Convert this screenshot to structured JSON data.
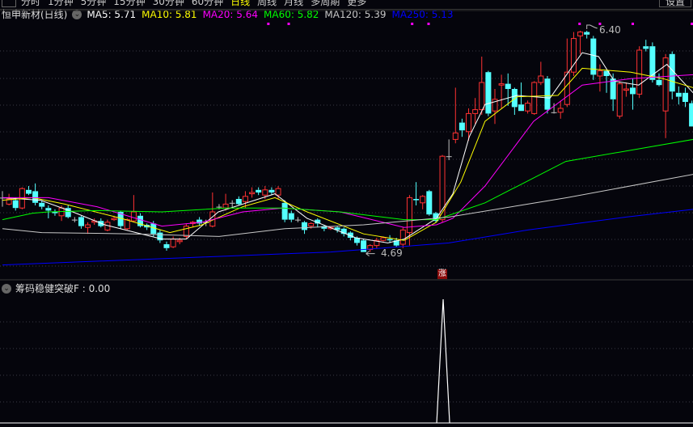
{
  "toolbar": {
    "periods": [
      "分时",
      "1分钟",
      "5分钟",
      "15分钟",
      "30分钟",
      "60分钟",
      "日线",
      "周线",
      "月线",
      "多周期",
      "更多"
    ],
    "active_period": "日线",
    "right_button": "设置"
  },
  "title": {
    "stock": "恒申新材(日线)",
    "ma": [
      {
        "label": "MA5: 5.71",
        "color": "#ffffff"
      },
      {
        "label": "MA10: 5.81",
        "color": "#ffff00"
      },
      {
        "label": "MA20: 5.64",
        "color": "#ff00ff"
      },
      {
        "label": "MA60: 5.82",
        "color": "#00ff00"
      },
      {
        "label": "MA120: 5.39",
        "color": "#c8c8c8"
      },
      {
        "label": "MA250: 5.13",
        "color": "#0000ff"
      }
    ]
  },
  "annotations": {
    "high_label": "6.40",
    "low_label": "4.69",
    "signal_badge": "涨"
  },
  "indicator": {
    "label": "筹码稳健突破F : 0.00"
  },
  "colors": {
    "up": "#ff3232",
    "down": "#54ffff",
    "doji": "#c0c0c0",
    "marker": "#ff00ff"
  },
  "chart_data": {
    "type": "candlestick",
    "price_range": [
      4.5,
      6.48
    ],
    "ohlc": [
      [
        5.11,
        5.16,
        5.04,
        5.11
      ],
      [
        5.06,
        5.14,
        5.05,
        5.1
      ],
      [
        5.09,
        5.11,
        5.01,
        5.03
      ],
      [
        5.03,
        5.19,
        5.02,
        5.18
      ],
      [
        5.17,
        5.2,
        5.13,
        5.14
      ],
      [
        5.16,
        5.22,
        5.05,
        5.07
      ],
      [
        5.07,
        5.09,
        5.02,
        5.04
      ],
      [
        5.03,
        5.05,
        4.95,
        5.01
      ],
      [
        5.0,
        5.02,
        4.97,
        4.99
      ],
      [
        4.97,
        5.05,
        4.93,
        5.03
      ],
      [
        5.03,
        5.05,
        4.95,
        4.96
      ],
      [
        4.94,
        4.96,
        4.92,
        4.94
      ],
      [
        4.96,
        4.97,
        4.87,
        4.89
      ],
      [
        4.88,
        4.92,
        4.83,
        4.9
      ],
      [
        4.92,
        4.95,
        4.9,
        4.93
      ],
      [
        4.93,
        4.95,
        4.88,
        4.89
      ],
      [
        4.86,
        4.94,
        4.85,
        4.92
      ],
      [
        4.94,
        4.97,
        4.93,
        4.95
      ],
      [
        5.0,
        5.01,
        4.87,
        4.89
      ],
      [
        4.87,
        4.95,
        4.86,
        4.94
      ],
      [
        4.93,
        5.13,
        4.92,
        5.0
      ],
      [
        4.97,
        4.99,
        4.88,
        4.89
      ],
      [
        4.9,
        4.91,
        4.86,
        4.88
      ],
      [
        4.91,
        4.93,
        4.81,
        4.83
      ],
      [
        4.84,
        4.86,
        4.76,
        4.78
      ],
      [
        4.75,
        4.77,
        4.7,
        4.72
      ],
      [
        4.73,
        4.81,
        4.72,
        4.79
      ],
      [
        4.77,
        4.8,
        4.75,
        4.78
      ],
      [
        4.81,
        4.91,
        4.79,
        4.89
      ],
      [
        4.91,
        4.93,
        4.88,
        4.92
      ],
      [
        4.94,
        4.96,
        4.89,
        4.91
      ],
      [
        4.92,
        4.94,
        4.89,
        4.92
      ],
      [
        4.89,
        5.15,
        4.88,
        5.0
      ],
      [
        5.04,
        5.06,
        5.02,
        5.04
      ],
      [
        5.03,
        5.14,
        5.01,
        5.06
      ],
      [
        5.07,
        5.09,
        5.03,
        5.07
      ],
      [
        5.1,
        5.12,
        5.05,
        5.06
      ],
      [
        5.08,
        5.16,
        5.03,
        5.12
      ],
      [
        5.14,
        5.19,
        5.11,
        5.15
      ],
      [
        5.17,
        5.19,
        5.13,
        5.15
      ],
      [
        5.13,
        5.2,
        5.1,
        5.17
      ],
      [
        5.17,
        5.19,
        5.13,
        5.15
      ],
      [
        5.13,
        5.2,
        5.1,
        5.18
      ],
      [
        5.07,
        5.09,
        4.92,
        4.94
      ],
      [
        4.99,
        5.01,
        4.92,
        4.94
      ],
      [
        4.94,
        4.96,
        4.92,
        4.94
      ],
      [
        4.92,
        4.93,
        4.83,
        4.86
      ],
      [
        4.89,
        4.92,
        4.87,
        4.91
      ],
      [
        4.94,
        4.95,
        4.88,
        4.91
      ],
      [
        4.89,
        4.9,
        4.85,
        4.87
      ],
      [
        4.87,
        4.89,
        4.86,
        4.88
      ],
      [
        4.88,
        4.89,
        4.84,
        4.86
      ],
      [
        4.87,
        4.88,
        4.81,
        4.83
      ],
      [
        4.84,
        4.85,
        4.78,
        4.8
      ],
      [
        4.8,
        4.81,
        4.74,
        4.76
      ],
      [
        4.78,
        4.79,
        4.69,
        4.69
      ],
      [
        4.71,
        4.75,
        4.69,
        4.74
      ],
      [
        4.74,
        4.8,
        4.72,
        4.78
      ],
      [
        4.78,
        4.81,
        4.77,
        4.8
      ],
      [
        4.79,
        4.82,
        4.76,
        4.78
      ],
      [
        4.78,
        4.8,
        4.73,
        4.74
      ],
      [
        4.75,
        4.88,
        4.72,
        4.86
      ],
      [
        4.84,
        5.13,
        4.74,
        5.11
      ],
      [
        5.1,
        5.23,
        5.05,
        5.09
      ],
      [
        5.07,
        5.13,
        5.02,
        5.12
      ],
      [
        5.16,
        5.17,
        4.97,
        4.98
      ],
      [
        4.99,
        5.0,
        4.92,
        4.93
      ],
      [
        4.94,
        5.44,
        4.92,
        5.43
      ],
      [
        5.43,
        5.56,
        5.4,
        5.43
      ],
      [
        5.56,
        5.96,
        5.53,
        5.61
      ],
      [
        5.69,
        5.72,
        5.58,
        5.63
      ],
      [
        5.62,
        5.8,
        5.55,
        5.76
      ],
      [
        5.76,
        5.88,
        5.68,
        5.79
      ],
      [
        5.79,
        6.2,
        5.75,
        6.0
      ],
      [
        6.08,
        6.09,
        5.74,
        5.76
      ],
      [
        5.78,
        5.95,
        5.68,
        5.87
      ],
      [
        5.98,
        6.06,
        5.8,
        5.99
      ],
      [
        5.99,
        6.07,
        5.82,
        5.95
      ],
      [
        5.95,
        5.96,
        5.75,
        5.81
      ],
      [
        5.83,
        6.0,
        5.78,
        5.78
      ],
      [
        5.78,
        5.86,
        5.76,
        5.84
      ],
      [
        5.76,
        6.01,
        5.75,
        6.0
      ],
      [
        6.0,
        6.16,
        5.98,
        6.05
      ],
      [
        6.03,
        6.05,
        5.76,
        5.79
      ],
      [
        5.77,
        5.84,
        5.76,
        5.77
      ],
      [
        5.77,
        5.86,
        5.72,
        5.8
      ],
      [
        5.83,
        6.34,
        5.81,
        6.08
      ],
      [
        6.08,
        6.39,
        6.05,
        6.34
      ],
      [
        6.36,
        6.4,
        6.22,
        6.39
      ],
      [
        6.39,
        6.4,
        6.34,
        6.37
      ],
      [
        6.34,
        6.36,
        6.02,
        6.06
      ],
      [
        6.05,
        6.14,
        5.93,
        6.09
      ],
      [
        6.09,
        6.1,
        5.92,
        6.05
      ],
      [
        6.03,
        6.07,
        5.78,
        5.87
      ],
      [
        5.74,
        6.01,
        5.72,
        5.99
      ],
      [
        5.94,
        6.0,
        5.89,
        5.95
      ],
      [
        5.96,
        6.03,
        5.79,
        5.91
      ],
      [
        5.91,
        6.28,
        5.88,
        6.25
      ],
      [
        6.28,
        6.33,
        6.24,
        6.26
      ],
      [
        6.28,
        6.31,
        6.0,
        6.02
      ],
      [
        6.02,
        6.07,
        5.97,
        5.98
      ],
      [
        5.78,
        6.22,
        5.57,
        6.19
      ],
      [
        6.22,
        6.24,
        5.87,
        5.93
      ],
      [
        5.92,
        5.97,
        5.83,
        5.89
      ],
      [
        5.92,
        5.96,
        5.81,
        5.85
      ],
      [
        5.84,
        5.86,
        5.66,
        5.66
      ]
    ],
    "ma_series": [
      {
        "name": "MA5",
        "color": "#ffffff",
        "points": [
          [
            0,
            5.11
          ],
          [
            5.8,
            5.09
          ],
          [
            10.7,
            5.0
          ],
          [
            15.6,
            4.9
          ],
          [
            24.3,
            4.79
          ],
          [
            28,
            4.79
          ],
          [
            32.9,
            5.0
          ],
          [
            41.5,
            5.14
          ],
          [
            46.4,
            4.95
          ],
          [
            53.8,
            4.8
          ],
          [
            58.7,
            4.76
          ],
          [
            61.2,
            4.79
          ],
          [
            66.1,
            4.95
          ],
          [
            68.6,
            5.14
          ],
          [
            71.1,
            5.58
          ],
          [
            73.5,
            5.83
          ],
          [
            78.4,
            5.9
          ],
          [
            83.4,
            5.88
          ],
          [
            88.3,
            6.23
          ],
          [
            90.8,
            6.2
          ],
          [
            93.2,
            6.01
          ],
          [
            96.9,
            5.98
          ],
          [
            101.2,
            6.14
          ],
          [
            105.2,
            5.92
          ]
        ]
      },
      {
        "name": "MA10",
        "color": "#ffff00",
        "points": [
          [
            0,
            5.09
          ],
          [
            4.6,
            5.11
          ],
          [
            9.5,
            5.06
          ],
          [
            18.1,
            4.95
          ],
          [
            25.5,
            4.84
          ],
          [
            30.4,
            4.9
          ],
          [
            36.6,
            5.04
          ],
          [
            41.5,
            5.11
          ],
          [
            46.4,
            5.0
          ],
          [
            55,
            4.83
          ],
          [
            61.2,
            4.78
          ],
          [
            66.1,
            4.92
          ],
          [
            69.8,
            5.23
          ],
          [
            73.5,
            5.7
          ],
          [
            78.4,
            5.89
          ],
          [
            84.6,
            5.9
          ],
          [
            88.3,
            6.11
          ],
          [
            95.7,
            6.08
          ],
          [
            100.6,
            6.03
          ],
          [
            105.2,
            5.96
          ]
        ]
      },
      {
        "name": "MA20",
        "color": "#ff00ff",
        "points": [
          [
            0,
            5.11
          ],
          [
            7,
            5.11
          ],
          [
            14.4,
            5.04
          ],
          [
            24.3,
            4.89
          ],
          [
            30.4,
            4.92
          ],
          [
            36.6,
            5.0
          ],
          [
            42.7,
            5.03
          ],
          [
            51.4,
            5.0
          ],
          [
            61.2,
            4.88
          ],
          [
            66.1,
            4.9
          ],
          [
            68.6,
            4.95
          ],
          [
            73.5,
            5.2
          ],
          [
            80.9,
            5.7
          ],
          [
            88.3,
            5.98
          ],
          [
            95.7,
            6.03
          ],
          [
            105.2,
            6.06
          ]
        ]
      },
      {
        "name": "MA60",
        "color": "#00ff00",
        "points": [
          [
            0,
            4.94
          ],
          [
            4.6,
            4.99
          ],
          [
            7,
            5.0
          ],
          [
            14.4,
            5.01
          ],
          [
            24.3,
            5.0
          ],
          [
            34.1,
            5.03
          ],
          [
            42.7,
            5.03
          ],
          [
            51.4,
            5.0
          ],
          [
            61.2,
            4.94
          ],
          [
            66.1,
            4.94
          ],
          [
            73.5,
            5.07
          ],
          [
            85.8,
            5.39
          ],
          [
            105.2,
            5.56
          ]
        ]
      },
      {
        "name": "MA120",
        "color": "#c8c8c8",
        "points": [
          [
            0,
            4.87
          ],
          [
            6,
            4.84
          ],
          [
            20,
            4.83
          ],
          [
            33,
            4.81
          ],
          [
            43,
            4.87
          ],
          [
            55,
            4.9
          ],
          [
            68,
            4.96
          ],
          [
            86,
            5.11
          ],
          [
            105.2,
            5.29
          ]
        ]
      },
      {
        "name": "MA250",
        "color": "#0000ff",
        "points": [
          [
            0,
            4.59
          ],
          [
            30,
            4.65
          ],
          [
            50,
            4.69
          ],
          [
            68,
            4.76
          ],
          [
            80,
            4.86
          ],
          [
            95,
            4.96
          ],
          [
            105.2,
            5.02
          ]
        ]
      }
    ],
    "top_markers": [
      40.5,
      43.6,
      62.4,
      64.9,
      87.9,
      91,
      96,
      105
    ],
    "indicator_series": {
      "name": "筹码稳健突破F",
      "signal_index": 67,
      "signal_value": 1,
      "ylim": [
        0,
        1
      ]
    }
  }
}
